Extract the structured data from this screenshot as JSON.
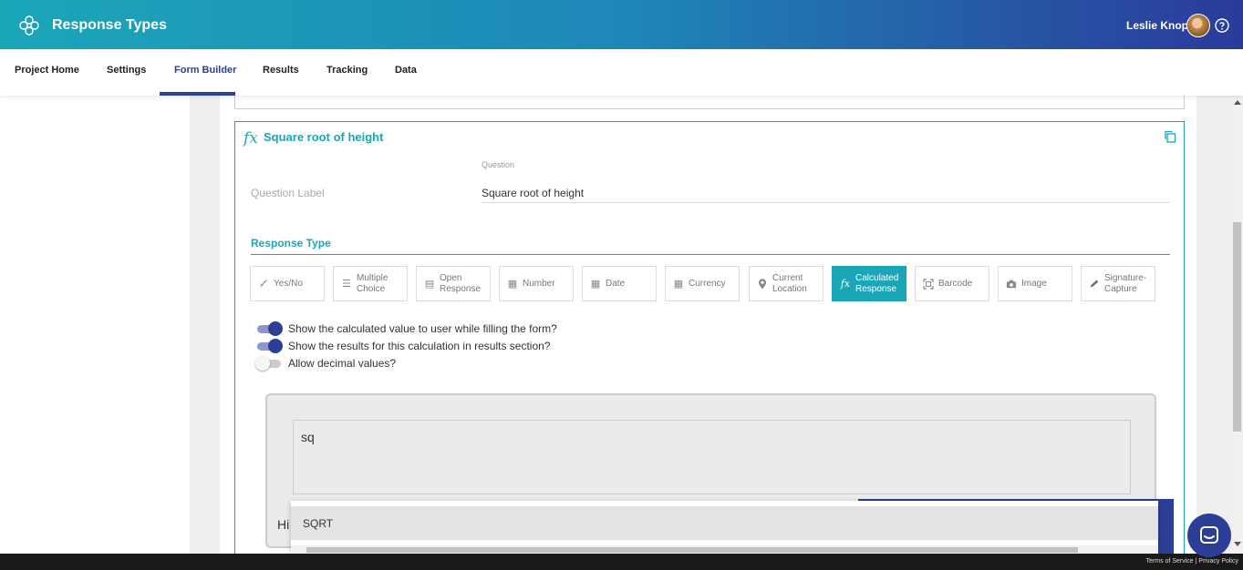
{
  "header": {
    "title": "Response Types",
    "logo_icon": "flower-logo-icon",
    "user_name": "Leslie Knope",
    "help_icon": "help-circle-icon",
    "gradient": [
      "#1ba6b8",
      "#2b3a9a"
    ]
  },
  "nav": {
    "tabs": [
      {
        "label": "Project Home",
        "active": false
      },
      {
        "label": "Settings",
        "active": false
      },
      {
        "label": "Form Builder",
        "active": true
      },
      {
        "label": "Results",
        "active": false
      },
      {
        "label": "Tracking",
        "active": false
      },
      {
        "label": "Data",
        "active": false
      }
    ],
    "active_color": "#2d3e96"
  },
  "card": {
    "title_icon": "fx-icon",
    "title": "Square root of height",
    "copy_icon": "copy-icon",
    "question_small_label": "Question",
    "question_label_placeholder": "Question Label",
    "question_value": "Square root of height",
    "response_type_heading": "Response Type",
    "accent_color": "#1ba6b8"
  },
  "response_types": [
    {
      "label": "Yes/No",
      "icon": "yes-no-icon",
      "active": false
    },
    {
      "label": "Multiple Choice",
      "icon": "list-icon",
      "active": false
    },
    {
      "label": "Open Response",
      "icon": "text-box-icon",
      "active": false
    },
    {
      "label": "Number",
      "icon": "calculator-icon",
      "active": false
    },
    {
      "label": "Date",
      "icon": "calendar-icon",
      "active": false
    },
    {
      "label": "Currency",
      "icon": "calculator-icon",
      "active": false
    },
    {
      "label": "Current Location",
      "icon": "location-pin-icon",
      "active": false
    },
    {
      "label": "Calculated Response",
      "icon": "fx-icon",
      "active": true
    },
    {
      "label": "Barcode",
      "icon": "barcode-icon",
      "active": false
    },
    {
      "label": "Image",
      "icon": "camera-icon",
      "active": false
    },
    {
      "label": "Signature-Capture",
      "icon": "pen-icon",
      "active": false
    }
  ],
  "toggles": [
    {
      "label": "Show the calculated value to user while filling the form?",
      "on": true
    },
    {
      "label": "Show the results for this calculation in results section?",
      "on": true
    },
    {
      "label": "Allow decimal values?",
      "on": false
    }
  ],
  "formula": {
    "input_value": "sq",
    "hint_text": "Hi"
  },
  "autocomplete": {
    "items": [
      "SQRT"
    ]
  },
  "footer": {
    "terms": "Terms of Service",
    "separator": "|",
    "privacy": "Privacy Policy"
  },
  "chat": {
    "icon": "chat-icon"
  }
}
